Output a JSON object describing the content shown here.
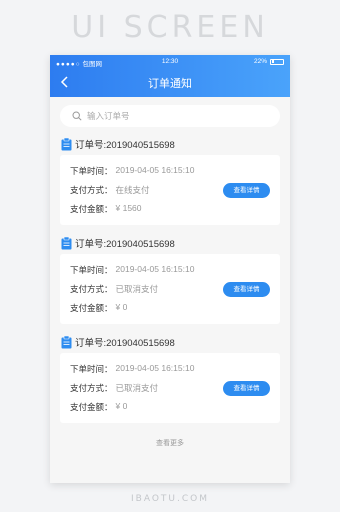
{
  "watermark": {
    "title": "UI SCREEN",
    "footer": "IBAOTU.COM"
  },
  "status_bar": {
    "carrier": "包图网",
    "time": "12:30",
    "battery": "22%",
    "battery_level": 0.22
  },
  "nav": {
    "title": "订单通知",
    "back_icon": "chevron-left-icon"
  },
  "search": {
    "placeholder": "输入订单号"
  },
  "orders": [
    {
      "order_label": "订单号:2019040515698",
      "time_key": "下单时间：",
      "time_value": "2019-04-05  16:15:10",
      "pay_key": "支付方式：",
      "pay_value": "在线支付",
      "amount_key": "支付金额：",
      "amount_value": "¥ 1560",
      "button": "查看详情"
    },
    {
      "order_label": "订单号:2019040515698",
      "time_key": "下单时间：",
      "time_value": "2019-04-05  16:15:10",
      "pay_key": "支付方式：",
      "pay_value": "已取消支付",
      "amount_key": "支付金额：",
      "amount_value": "¥ 0",
      "button": "查看详情"
    },
    {
      "order_label": "订单号:2019040515698",
      "time_key": "下单时间：",
      "time_value": "2019-04-05  16:15:10",
      "pay_key": "支付方式：",
      "pay_value": "已取消支付",
      "amount_key": "支付金额：",
      "amount_value": "¥ 0",
      "button": "查看详情"
    }
  ],
  "load_more": "查看更多",
  "colors": {
    "accent": "#2d8cf0",
    "header_start": "#2d7cf0",
    "header_end": "#4aa3fb"
  }
}
